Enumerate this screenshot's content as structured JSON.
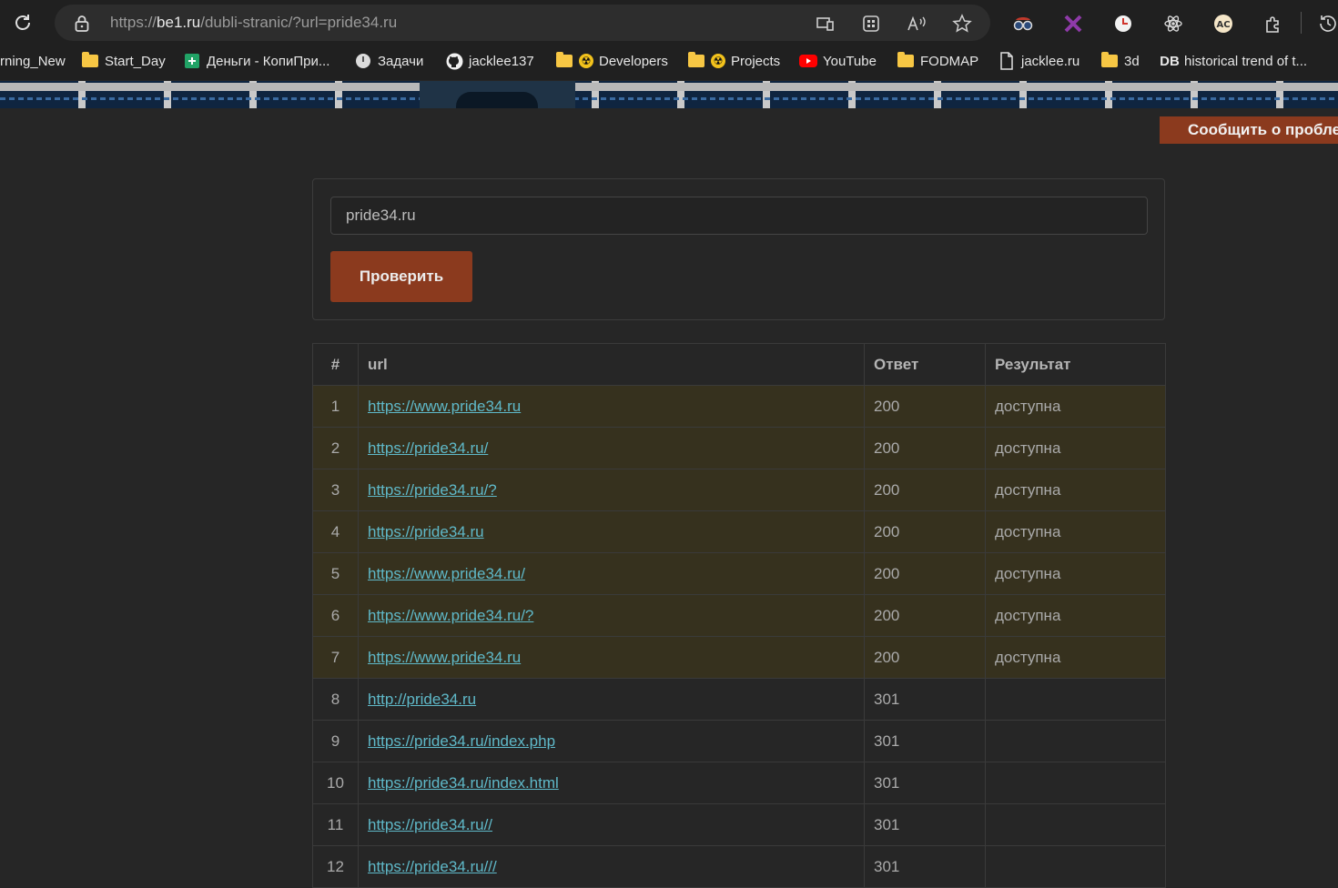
{
  "browser": {
    "url_prefix": "https://",
    "url_host": "be1.ru",
    "url_path": "/dubli-stranic/?url=pride34.ru"
  },
  "bookmarks": [
    {
      "label": "rning_New",
      "icon": "none"
    },
    {
      "label": "Start_Day",
      "icon": "folder-icon"
    },
    {
      "label": "Деньги - КопиПри...",
      "icon": "sheets-icon"
    },
    {
      "label": "Задачи",
      "icon": "circle-app-icon"
    },
    {
      "label": "jacklee137",
      "icon": "github-icon"
    },
    {
      "label": "Developers",
      "icon": "folder-radiation-icon"
    },
    {
      "label": "Projects",
      "icon": "folder-radiation-icon"
    },
    {
      "label": "YouTube",
      "icon": "youtube-icon"
    },
    {
      "label": "FODMAP",
      "icon": "folder-icon"
    },
    {
      "label": "jacklee.ru",
      "icon": "page-icon"
    },
    {
      "label": "3d",
      "icon": "folder-icon"
    },
    {
      "label": "historical trend of t...",
      "icon": "db-icon",
      "badge": "DB"
    }
  ],
  "page": {
    "report_button": "Сообщить о пробле",
    "url_input_value": "pride34.ru",
    "check_button": "Проверить"
  },
  "table": {
    "headers": [
      "#",
      "url",
      "Ответ",
      "Результат"
    ],
    "rows": [
      {
        "n": "1",
        "url": "https://www.pride34.ru",
        "code": "200",
        "result": "доступна",
        "highlight": true
      },
      {
        "n": "2",
        "url": "https://pride34.ru/",
        "code": "200",
        "result": "доступна",
        "highlight": true
      },
      {
        "n": "3",
        "url": "https://pride34.ru/?",
        "code": "200",
        "result": "доступна",
        "highlight": true
      },
      {
        "n": "4",
        "url": "https://pride34.ru",
        "code": "200",
        "result": "доступна",
        "highlight": true
      },
      {
        "n": "5",
        "url": "https://www.pride34.ru/",
        "code": "200",
        "result": "доступна",
        "highlight": true
      },
      {
        "n": "6",
        "url": "https://www.pride34.ru/?",
        "code": "200",
        "result": "доступна",
        "highlight": true
      },
      {
        "n": "7",
        "url": "https://www.pride34.ru",
        "code": "200",
        "result": "доступна",
        "highlight": true
      },
      {
        "n": "8",
        "url": "http://pride34.ru",
        "code": "301",
        "result": "",
        "highlight": false
      },
      {
        "n": "9",
        "url": "https://pride34.ru/index.php",
        "code": "301",
        "result": "",
        "highlight": false
      },
      {
        "n": "10",
        "url": "https://pride34.ru/index.html",
        "code": "301",
        "result": "",
        "highlight": false
      },
      {
        "n": "11",
        "url": "https://pride34.ru//",
        "code": "301",
        "result": "",
        "highlight": false
      },
      {
        "n": "12",
        "url": "https://pride34.ru///",
        "code": "301",
        "result": "",
        "highlight": false
      }
    ]
  }
}
